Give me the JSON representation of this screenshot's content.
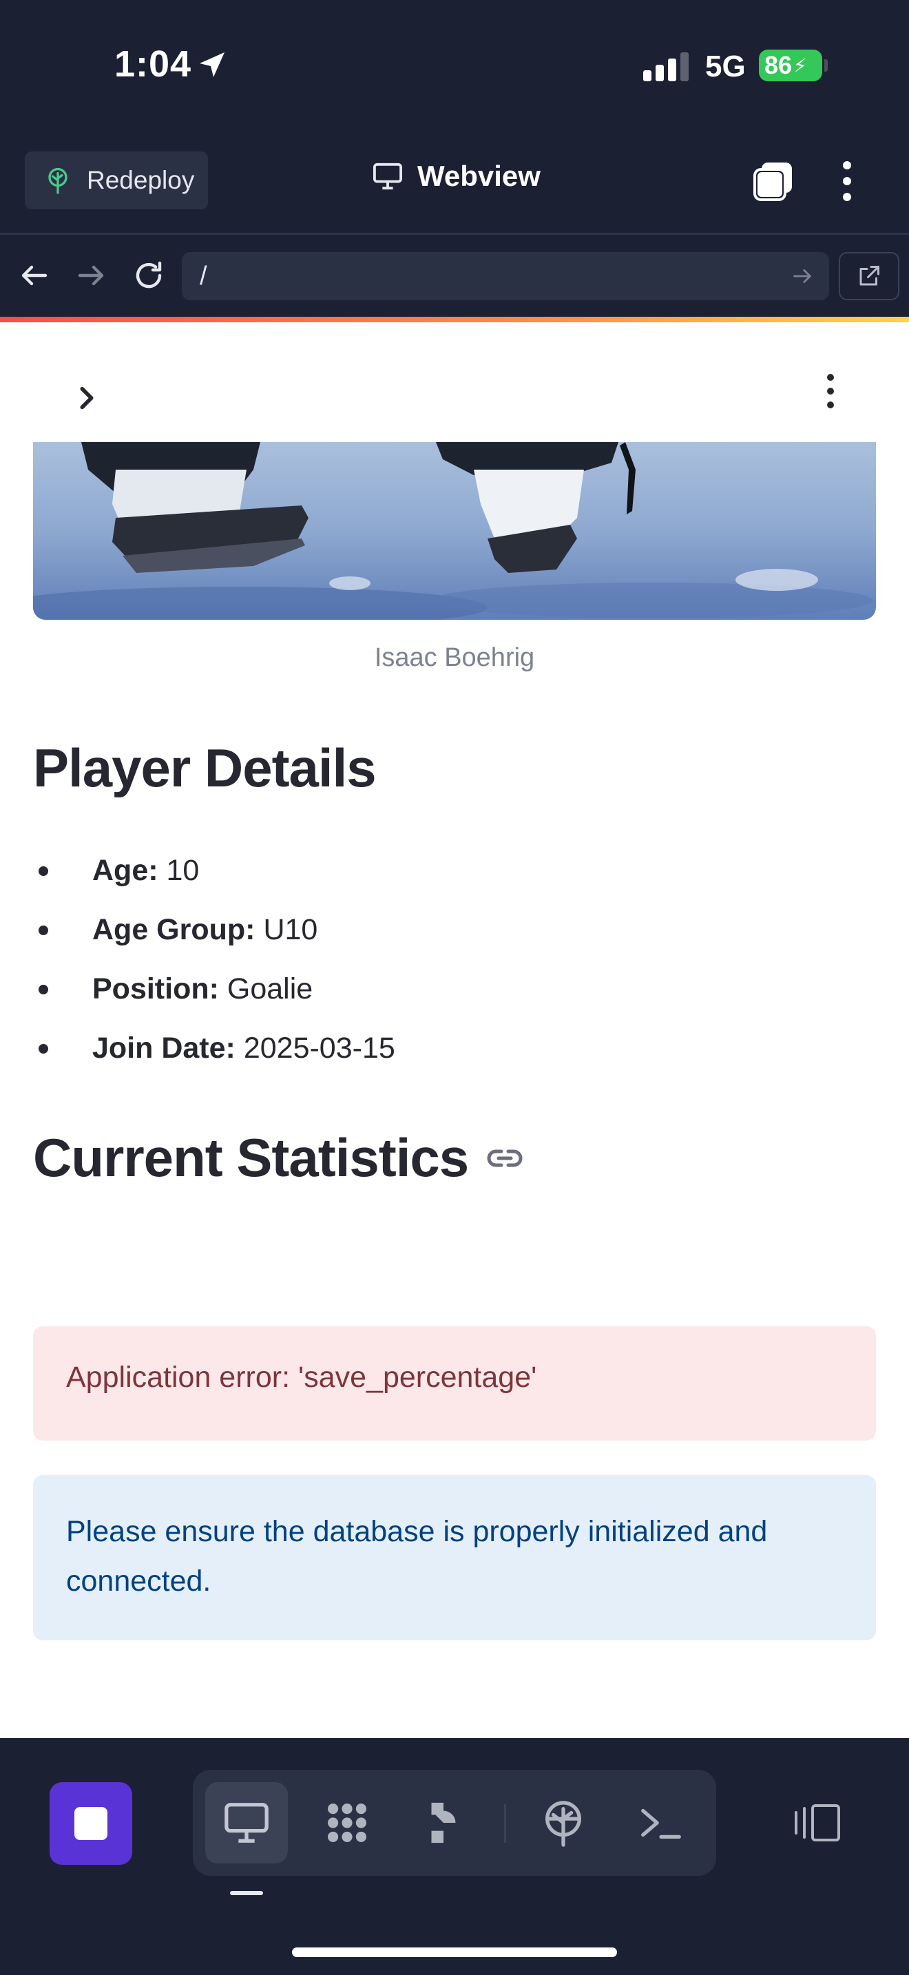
{
  "status_bar": {
    "time": "1:04",
    "network": "5G",
    "battery": "86"
  },
  "header": {
    "redeploy_label": "Redeploy",
    "title": "Webview"
  },
  "url_bar": {
    "value": "/"
  },
  "app": {
    "image_caption": "Isaac Boehrig",
    "details_heading": "Player Details",
    "details": [
      {
        "label": "Age:",
        "value": "10"
      },
      {
        "label": "Age Group:",
        "value": "U10"
      },
      {
        "label": "Position:",
        "value": "Goalie"
      },
      {
        "label": "Join Date:",
        "value": "2025-03-15"
      }
    ],
    "stats_heading": "Current Statistics",
    "error_message": "Application error: 'save_percentage'",
    "info_message": "Please ensure the database is properly initialized and connected."
  },
  "colors": {
    "chrome_bg": "#1c2033",
    "stop_button": "#5a33d6",
    "error_bg": "#fde8e9",
    "error_text": "#7d353b",
    "info_bg": "#e5eff9",
    "info_text": "#004280"
  },
  "bottom_tools": [
    "desktop-icon",
    "workspace-icon",
    "agent-icon",
    "deploy-icon",
    "shell-icon"
  ]
}
